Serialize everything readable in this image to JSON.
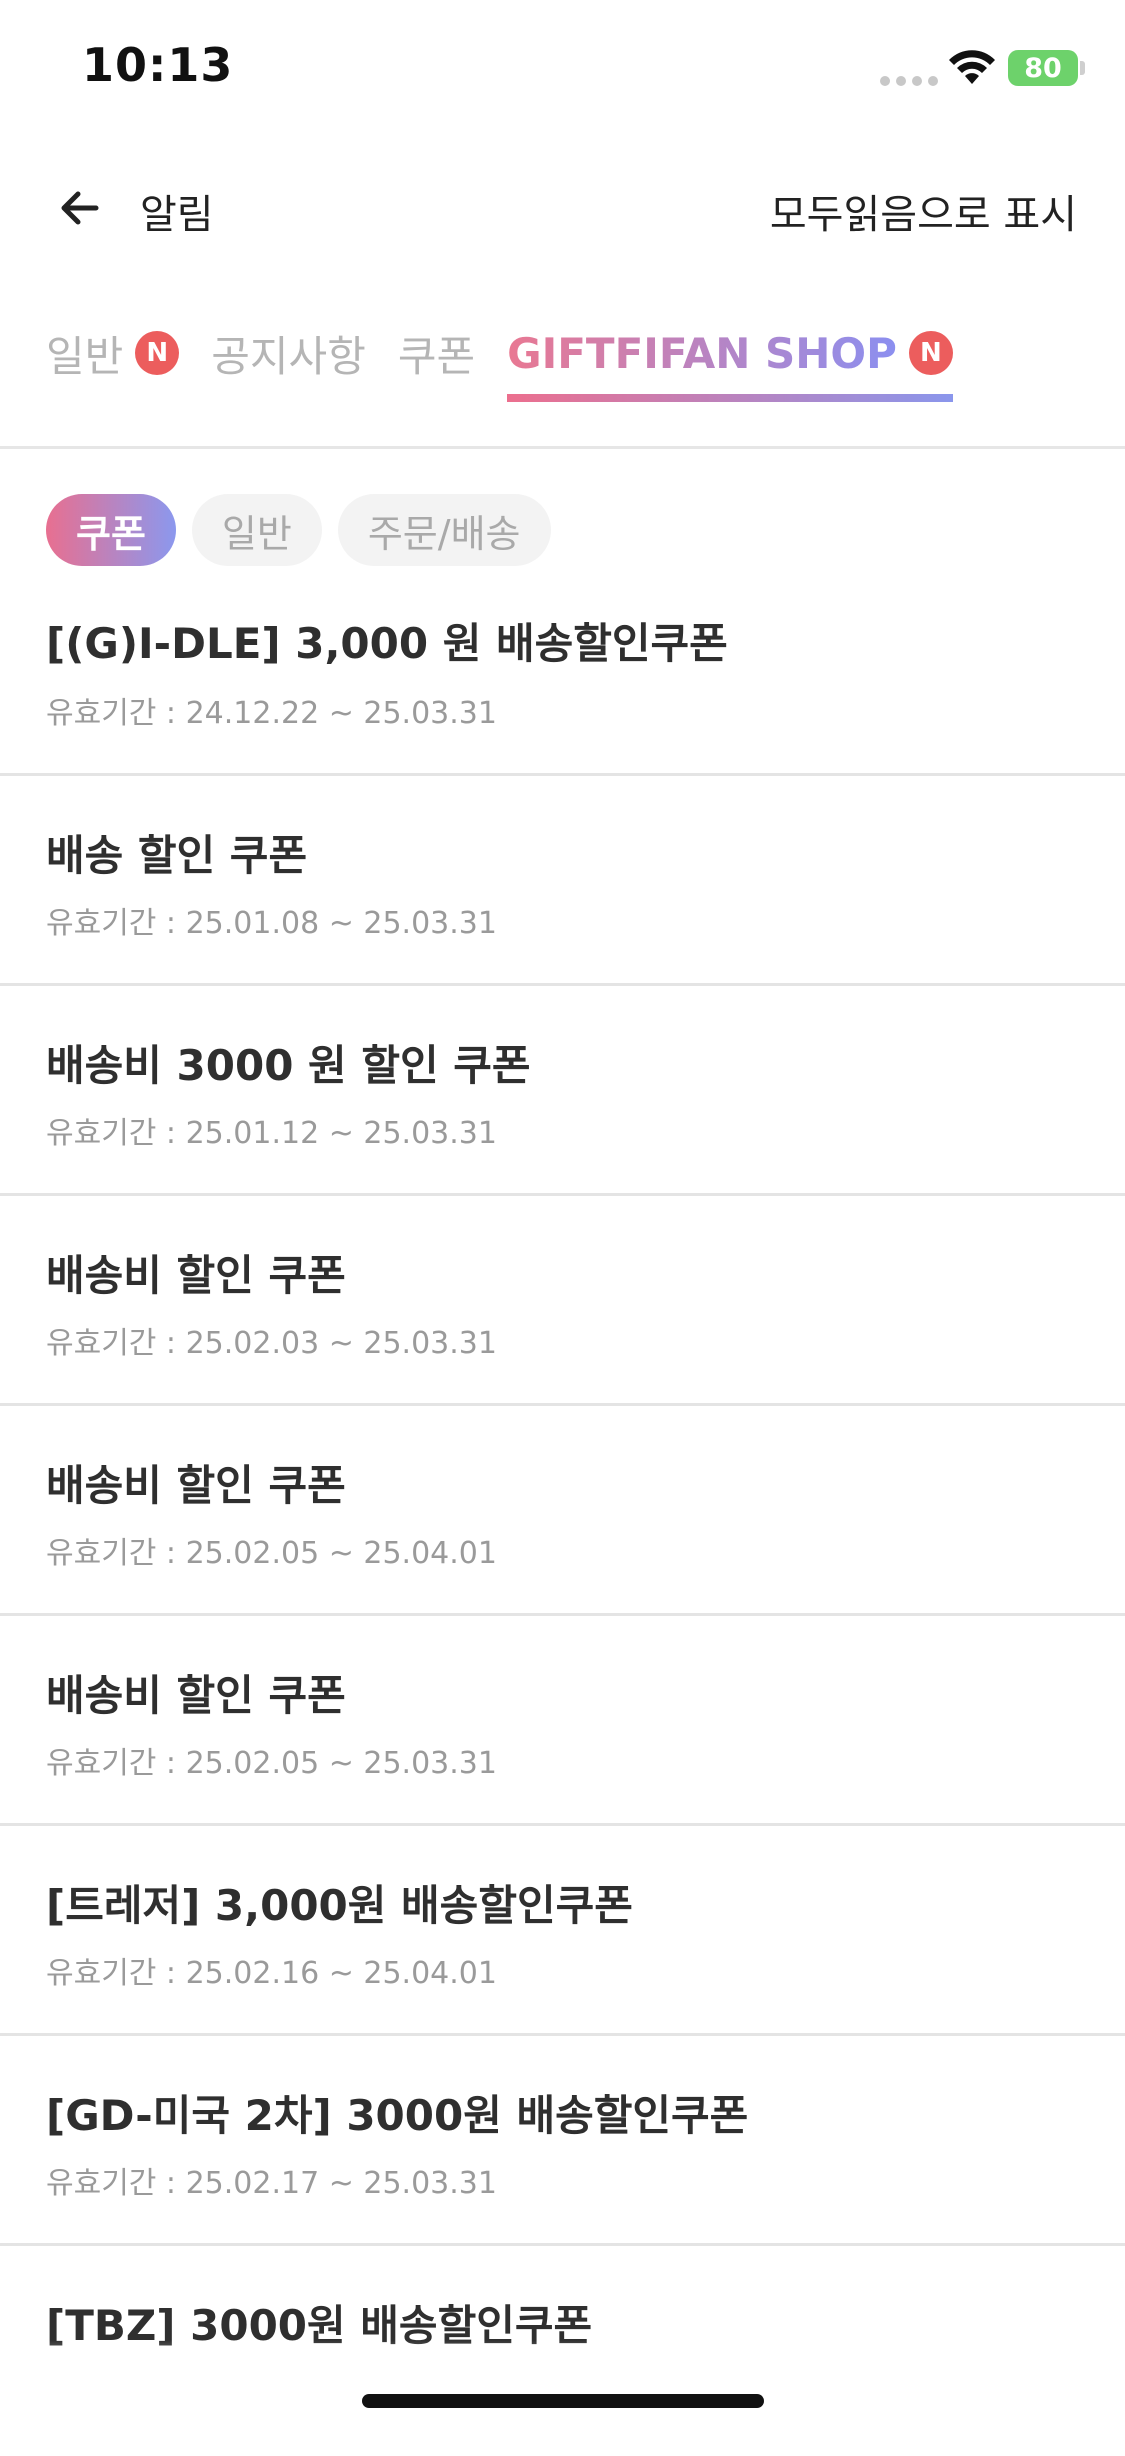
{
  "status_bar": {
    "time": "10:13",
    "battery": "80"
  },
  "header": {
    "title": "알림",
    "mark_all_read": "모두읽음으로 표시"
  },
  "tabs": [
    {
      "label": "일반",
      "badge": "N",
      "active": false
    },
    {
      "label": "공지사항",
      "badge": "",
      "active": false
    },
    {
      "label": "쿠폰",
      "badge": "",
      "active": false
    },
    {
      "label": "GIFTFIFAN SHOP",
      "badge": "N",
      "active": true
    }
  ],
  "chips": [
    {
      "label": "쿠폰",
      "active": true
    },
    {
      "label": "일반",
      "active": false
    },
    {
      "label": "주문/배송",
      "active": false
    }
  ],
  "notifications": [
    {
      "title": "[(G)I-DLE] 3,000 원 배송할인쿠폰",
      "period": "유효기간 : 24.12.22 ~ 25.03.31"
    },
    {
      "title": "배송 할인 쿠폰",
      "period": "유효기간 : 25.01.08 ~ 25.03.31"
    },
    {
      "title": "배송비 3000 원 할인 쿠폰",
      "period": "유효기간 : 25.01.12 ~ 25.03.31"
    },
    {
      "title": "배송비 할인 쿠폰",
      "period": "유효기간 : 25.02.03 ~ 25.03.31"
    },
    {
      "title": "배송비 할인 쿠폰",
      "period": "유효기간 : 25.02.05 ~ 25.04.01"
    },
    {
      "title": "배송비 할인 쿠폰",
      "period": "유효기간 : 25.02.05 ~ 25.03.31"
    },
    {
      "title": "[트레저] 3,000원 배송할인쿠폰",
      "period": "유효기간 : 25.02.16 ~ 25.04.01"
    },
    {
      "title": "[GD-미국 2차]  3000원 배송할인쿠폰",
      "period": "유효기간 : 25.02.17 ~ 25.03.31"
    },
    {
      "title": "[TBZ]  3000원 배송할인쿠폰",
      "period": ""
    }
  ],
  "colors": {
    "accent_start": "#e97892",
    "accent_end": "#8b8ff0",
    "badge": "#ec5d5d",
    "battery": "#6dd26b"
  },
  "icons": {
    "back": "arrow-left-icon",
    "wifi": "wifi-icon",
    "signal": "signal-icon",
    "battery": "battery-icon"
  }
}
